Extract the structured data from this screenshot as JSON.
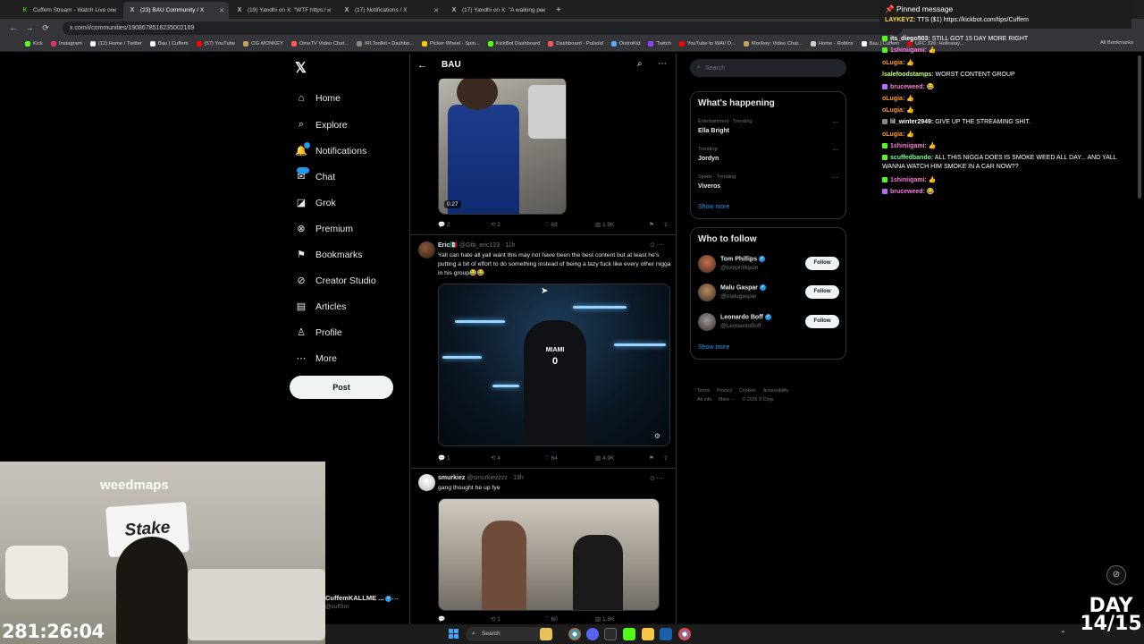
{
  "browser": {
    "tabs": [
      {
        "label": "Cuffem Stream - Watch Live on",
        "fav": "K",
        "active": false
      },
      {
        "label": "(23) BAU Community / X",
        "fav": "X",
        "active": true
      },
      {
        "label": "(19) Yandhi on X: \"WTF https:/",
        "fav": "X",
        "active": false
      },
      {
        "label": "(17) Notifications / X",
        "fav": "X",
        "active": false
      },
      {
        "label": "(17) Yandhi on X: \"A walking pe",
        "fav": "X",
        "active": false
      }
    ],
    "url": "x.com/i/communities/1908678516235002169",
    "bookmarks": [
      {
        "label": "Kick",
        "color": "#53fc18"
      },
      {
        "label": "Instagram",
        "color": "#e1306c"
      },
      {
        "label": "(12) Home / Twitter",
        "color": "#ffffff"
      },
      {
        "label": "Bau | Cuffem",
        "color": "#ffffff"
      },
      {
        "label": "(57) YouTube",
        "color": "#ff0000"
      },
      {
        "label": "OG MONKEY",
        "color": "#c8a060"
      },
      {
        "label": "OmeTV Video Chat...",
        "color": "#ff5a5a"
      },
      {
        "label": "IRLToolkit • Dashbo...",
        "color": "#888888"
      },
      {
        "label": "Picker Wheel - Spin...",
        "color": "#ffcc00"
      },
      {
        "label": "KickBot Dashboard",
        "color": "#53fc18"
      },
      {
        "label": "Dashboard - Pulsoid",
        "color": "#ff5555"
      },
      {
        "label": "DistroKid",
        "color": "#55aaff"
      },
      {
        "label": "Twitch",
        "color": "#9146ff"
      },
      {
        "label": "YouTube to WAV D...",
        "color": "#ff0000"
      },
      {
        "label": "Monkey: Video Chat...",
        "color": "#c8a060"
      },
      {
        "label": "Home - Roblox",
        "color": "#cccccc"
      },
      {
        "label": "Bau | Cuffem",
        "color": "#ffffff"
      },
      {
        "label": "UFC 326: Holloway...",
        "color": "#d20a0a"
      }
    ],
    "all_bookmarks": "All Bookmarks"
  },
  "nav": {
    "items": [
      {
        "label": "Home",
        "icon": "home-icon",
        "glyph": "⌂"
      },
      {
        "label": "Explore",
        "icon": "search-icon",
        "glyph": "⌕"
      },
      {
        "label": "Notifications",
        "icon": "bell-icon",
        "glyph": "🔔"
      },
      {
        "label": "Chat",
        "icon": "chat-icon",
        "glyph": "✉"
      },
      {
        "label": "Grok",
        "icon": "grok-icon",
        "glyph": "◪"
      },
      {
        "label": "Premium",
        "icon": "premium-icon",
        "glyph": "⊗"
      },
      {
        "label": "Bookmarks",
        "icon": "bookmark-icon",
        "glyph": "⚑"
      },
      {
        "label": "Creator Studio",
        "icon": "creator-icon",
        "glyph": "⊘"
      },
      {
        "label": "Articles",
        "icon": "article-icon",
        "glyph": "▤"
      },
      {
        "label": "Profile",
        "icon": "profile-icon",
        "glyph": "♙"
      },
      {
        "label": "More",
        "icon": "more-icon",
        "glyph": "⋯"
      }
    ],
    "post_label": "Post",
    "account": {
      "name": "CuffemKALLME ...",
      "handle": "@cuff3m"
    }
  },
  "feed": {
    "title": "BAU",
    "tweets": [
      {
        "duration": "0:27",
        "replies": "2",
        "reposts": "2",
        "likes": "68",
        "views": "1.9K"
      },
      {
        "name": "Eric🇲🇽",
        "handle": "@Gtb_eric123 · 11h",
        "text": "Yall can hate all yall want this may not have been the best content but at least he's putting a bit of effort to do something instead of being a lazy fuck like every other nigga in his group😂😂",
        "jersey_top": "MIAMI",
        "jersey_num": "0",
        "replies": "1",
        "reposts": "4",
        "likes": "64",
        "views": "4.9K"
      },
      {
        "name": "smurkiez",
        "handle": "@smurkiezzzz · 13h",
        "text": "gang thought he up fye",
        "replies": "",
        "reposts": "1",
        "likes": "60",
        "views": "1.8K"
      }
    ]
  },
  "sidebar": {
    "search_placeholder": "Search",
    "happening_title": "What's happening",
    "trends": [
      {
        "meta": "Entertainment · Trending",
        "name": "Ella Bright"
      },
      {
        "meta": "Trending",
        "name": "Jordyn"
      },
      {
        "meta": "Sports · Trending",
        "name": "Viveros"
      }
    ],
    "show_more": "Show more",
    "wtf_title": "Who to follow",
    "follow": [
      {
        "name": "Tom Phillips",
        "handle": "@tomphillipsin",
        "color": "#c96f4d"
      },
      {
        "name": "Malu Gaspar",
        "handle": "@malugaspar",
        "color": "#b88b60"
      },
      {
        "name": "Leonardo Boff",
        "handle": "@LeonardoBoff",
        "color": "#9a9a9a"
      }
    ],
    "follow_label": "Follow",
    "footer": [
      "Terms",
      "Privacy",
      "Cookies",
      "Accessibility",
      "Ad info",
      "More ···",
      "© 2026 X Corp."
    ]
  },
  "chat": {
    "pinned_title": "Pinned message",
    "pinned_user": "LAYKEYZ:",
    "pinned_text": "TTS ($1) https://kickbot.com/tips/Cuffem",
    "messages": [
      {
        "user": "its_diego503:",
        "text": "STILL GOT 15 DAY MORE RIGHT",
        "color": "#ffffff",
        "badge": "#53fc18"
      },
      {
        "user": "1shiniigami:",
        "text": "👍",
        "color": "#ff7ad9",
        "badge": "#53fc18"
      },
      {
        "user": "oLugia:",
        "text": "👍",
        "color": "#ff9a3c",
        "badge": ""
      },
      {
        "user": "lsalefoodstamps:",
        "text": "WORST CONTENT GROUP",
        "color": "#c8ff7a",
        "badge": ""
      },
      {
        "user": "bruceweed:",
        "text": "😂",
        "color": "#ff7ad9",
        "badge": "#b86cff"
      },
      {
        "user": "oLugia:",
        "text": "👍",
        "color": "#ff9a3c",
        "badge": ""
      },
      {
        "user": "oLugia:",
        "text": "👍",
        "color": "#ff9a3c",
        "badge": ""
      },
      {
        "user": "lil_winter2949:",
        "text": "GIVE UP THE STREAMING SHIT.",
        "color": "#ffffff",
        "badge": "#888888"
      },
      {
        "user": "oLugia:",
        "text": "👍",
        "color": "#ff9a3c",
        "badge": ""
      },
      {
        "user": "1shiniigami:",
        "text": "👍",
        "color": "#ff7ad9",
        "badge": "#53fc18"
      },
      {
        "user": "scuffedbando:",
        "text": "ALL THIS NIGGA DOES IS SMOKE WEED ALL DAY... AND YALL WANNA WATCH HIM SMOKE IN A CAR NOW??",
        "color": "#7aff9a",
        "badge": "#53fc18"
      },
      {
        "user": "1shiniigami:",
        "text": "👍",
        "color": "#ff7ad9",
        "badge": "#53fc18"
      },
      {
        "user": "bruceweed:",
        "text": "😂",
        "color": "#ff7ad9",
        "badge": "#b86cff"
      }
    ]
  },
  "stream": {
    "timer": "281:26:04",
    "day_label": "DAY",
    "day_value": "14/15",
    "sign": "weedmaps",
    "stake": "Stake"
  },
  "taskbar": {
    "search_label": "Search"
  }
}
